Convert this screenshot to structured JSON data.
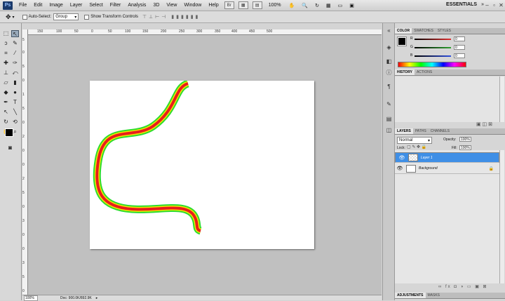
{
  "app": {
    "logo": "Ps"
  },
  "menubar": {
    "items": [
      "File",
      "Edit",
      "Image",
      "Layer",
      "Select",
      "Filter",
      "Analysis",
      "3D",
      "View",
      "Window",
      "Help"
    ],
    "zoom": "100%",
    "workspace": "ESSENTIALS"
  },
  "options": {
    "auto_select_label": "Auto-Select:",
    "auto_select_value": "Group",
    "transform_label": "Show Transform Controls"
  },
  "ruler": {
    "top": [
      "150",
      "100",
      "50",
      "0",
      "50",
      "100",
      "150",
      "200",
      "250",
      "300",
      "350",
      "400",
      "450",
      "500"
    ],
    "left": [
      "5",
      "0",
      "5",
      "0",
      "1",
      "5",
      "0",
      "2",
      "0",
      "0",
      "2",
      "5",
      "0",
      "3",
      "0",
      "0",
      "3",
      "5",
      "0"
    ]
  },
  "statusbar": {
    "zoom": "100%",
    "doc": "Doc: 900.0K/892.9K"
  },
  "color_panel": {
    "tabs": [
      "COLOR",
      "SWATCHES",
      "STYLES"
    ],
    "channels": [
      {
        "label": "R",
        "value": "0",
        "color": "#e03030"
      },
      {
        "label": "G",
        "value": "0",
        "color": "#30a030"
      },
      {
        "label": "B",
        "value": "0",
        "color": "#3050e0"
      }
    ]
  },
  "history_panel": {
    "tabs": [
      "HISTORY",
      "ACTIONS"
    ]
  },
  "layers_panel": {
    "tabs": [
      "LAYERS",
      "PATHS",
      "CHANNELS"
    ],
    "blend_mode": "Normal",
    "opacity_label": "Opacity:",
    "opacity": "100%",
    "lock_label": "Lock:",
    "fill_label": "Fill:",
    "fill": "100%",
    "layers": [
      {
        "name": "Layer 1",
        "selected": true
      },
      {
        "name": "Background",
        "selected": false
      }
    ]
  },
  "adjust_panel": {
    "tabs": [
      "ADJUSTMENTS",
      "MASKS"
    ]
  },
  "colors": {
    "accent": "#3f8fe6",
    "stroke_red": "#e81c1c",
    "stroke_yellow": "#f4e400",
    "stroke_green": "#2ddc2d"
  }
}
